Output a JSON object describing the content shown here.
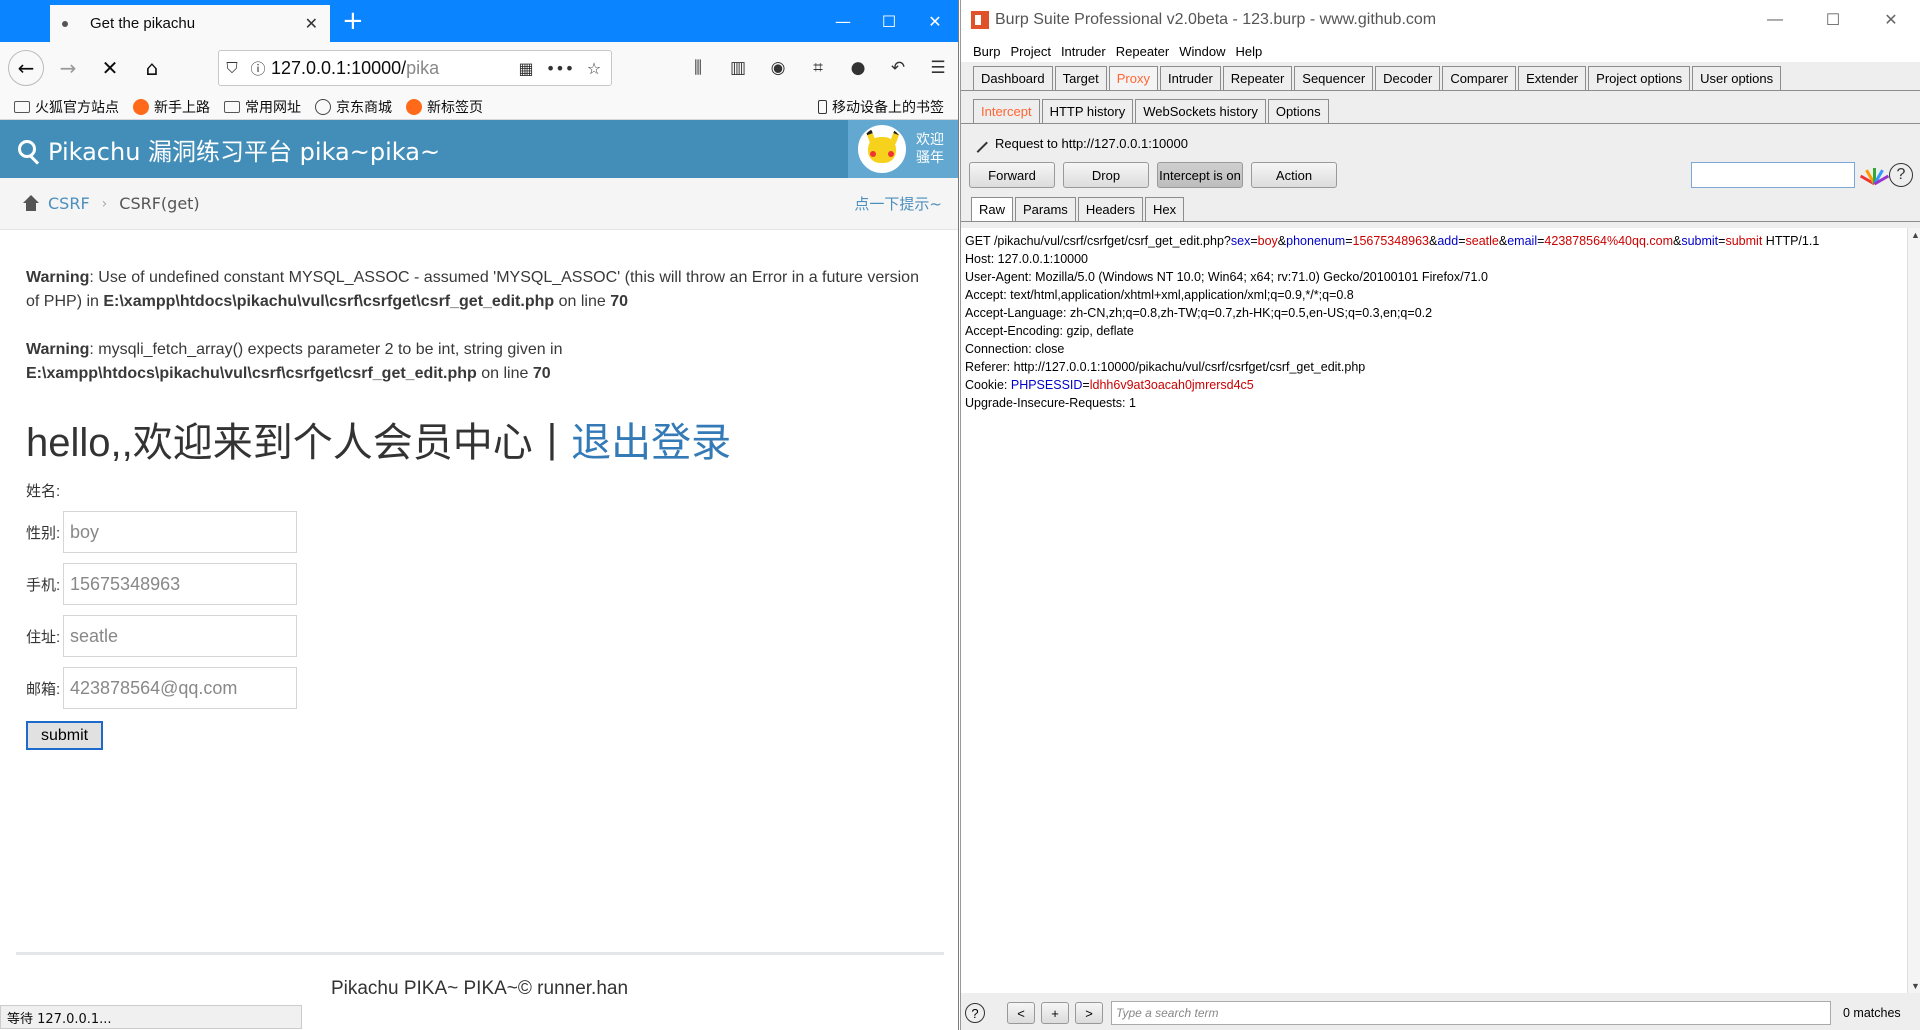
{
  "firefox": {
    "tab_title": "Get the pikachu",
    "tab_close": "✕",
    "new_tab": "+",
    "win_min": "—",
    "win_max": "☐",
    "win_close": "✕",
    "url_host": "127.0.0.1:10000/",
    "url_rest": "pika",
    "bookmarks": [
      "火狐官方站点",
      "新手上路",
      "常用网址",
      "京东商城",
      "新标签页"
    ],
    "mobile_bookmarks": "移动设备上的书签",
    "status": "等待 127.0.0.1..."
  },
  "pikachu": {
    "brand": "Pikachu 漏洞练习平台 pika~pika~",
    "welcome_line1": "欢迎",
    "welcome_line2": "骚年",
    "breadcrumb_link": "CSRF",
    "breadcrumb_sep": "›",
    "breadcrumb_current": "CSRF(get)",
    "hint": "点一下提示~",
    "warning1": {
      "label": "Warning",
      "text1": ": Use of undefined constant MYSQL_ASSOC - assumed 'MYSQL_ASSOC' (this will throw an Error in a future version of PHP) in ",
      "path": "E:\\xampp\\htdocs\\pikachu\\vul\\csrf\\csrfget\\csrf_get_edit.php",
      "text2": " on line ",
      "line": "70"
    },
    "warning2": {
      "label": "Warning",
      "text1": ": mysqli_fetch_array() expects parameter 2 to be int, string given in ",
      "path": "E:\\xampp\\htdocs\\pikachu\\vul\\csrf\\csrfget\\csrf_get_edit.php",
      "text2": " on line ",
      "line": "70"
    },
    "hello": "hello,,欢迎来到个人会员中心",
    "hello_sep": "|",
    "logout": "退出登录",
    "name_label": "姓名:",
    "fields": [
      {
        "label": "性别:",
        "value": "boy"
      },
      {
        "label": "手机:",
        "value": "15675348963"
      },
      {
        "label": "住址:",
        "value": "seatle"
      },
      {
        "label": "邮箱:",
        "value": "423878564@qq.com"
      }
    ],
    "submit": "submit",
    "footer": "Pikachu PIKA~ PIKA~© runner.han"
  },
  "burp": {
    "title": "Burp Suite Professional v2.0beta - 123.burp - www.github.com",
    "win_min": "—",
    "win_max": "☐",
    "win_close": "✕",
    "menu": [
      "Burp",
      "Project",
      "Intruder",
      "Repeater",
      "Window",
      "Help"
    ],
    "main_tabs": [
      "Dashboard",
      "Target",
      "Proxy",
      "Intruder",
      "Repeater",
      "Sequencer",
      "Decoder",
      "Comparer",
      "Extender",
      "Project options",
      "User options"
    ],
    "active_main_tab": "Proxy",
    "proxy_tabs": [
      "Intercept",
      "HTTP history",
      "WebSockets history",
      "Options"
    ],
    "active_proxy_tab": "Intercept",
    "request_to": "Request to http://127.0.0.1:10000",
    "buttons": {
      "forward": "Forward",
      "drop": "Drop",
      "intercept": "Intercept is on",
      "action": "Action"
    },
    "help": "?",
    "view_tabs": [
      "Raw",
      "Params",
      "Headers",
      "Hex"
    ],
    "active_view_tab": "Raw",
    "request": {
      "get_prefix": "GET /pikachu/vul/csrf/csrfget/csrf_get_edit.php?",
      "params": [
        {
          "name": "sex",
          "value": "boy"
        },
        {
          "name": "phonenum",
          "value": "15675348963"
        },
        {
          "name": "add",
          "value": "seatle"
        },
        {
          "name": "email",
          "value": "423878564%40qq.com"
        },
        {
          "name": "submit",
          "value": "submit"
        }
      ],
      "get_suffix": " HTTP/1.1",
      "headers": [
        "Host: 127.0.0.1:10000",
        "User-Agent: Mozilla/5.0 (Windows NT 10.0; Win64; x64; rv:71.0) Gecko/20100101 Firefox/71.0",
        "Accept: text/html,application/xhtml+xml,application/xml;q=0.9,*/*;q=0.8",
        "Accept-Language: zh-CN,zh;q=0.8,zh-TW;q=0.7,zh-HK;q=0.5,en-US;q=0.3,en;q=0.2",
        "Accept-Encoding: gzip, deflate",
        "Connection: close",
        "Referer: http://127.0.0.1:10000/pikachu/vul/csrf/csrfget/csrf_get_edit.php"
      ],
      "cookie_prefix": "Cookie: ",
      "cookie_name": "PHPSESSID",
      "cookie_value": "ldhh6v9at3oacah0jmrersd4c5",
      "last_header": "Upgrade-Insecure-Requests: 1"
    },
    "bottom": {
      "help": "?",
      "prev": "<",
      "add": "+",
      "next": ">",
      "search_placeholder": "Type a search term",
      "matches": "0 matches"
    }
  }
}
